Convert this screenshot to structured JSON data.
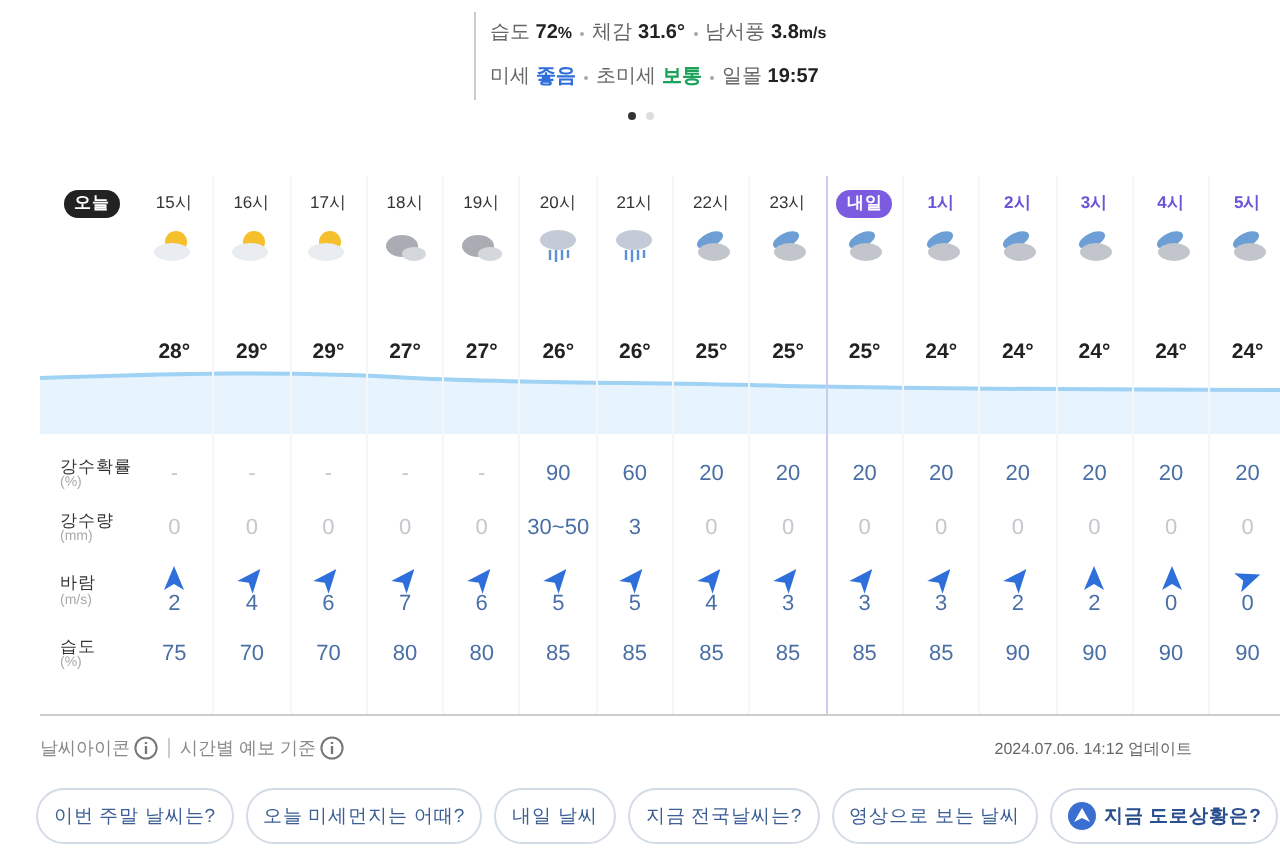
{
  "summary": {
    "lines": [
      [
        {
          "label": "습도",
          "value": "72",
          "unit": "%"
        },
        {
          "label": "체감",
          "value": "31.6°"
        },
        {
          "label": "남서풍",
          "value": "3.8",
          "unit": "m/s"
        }
      ],
      [
        {
          "label": "미세",
          "value": "좋음",
          "color": "#2f6fdb"
        },
        {
          "label": "초미세",
          "value": "보통",
          "color": "#1aa15a"
        },
        {
          "label": "일몰",
          "value": "19:57"
        }
      ]
    ],
    "pages": [
      {
        "selected": true
      },
      {
        "selected": false
      }
    ]
  },
  "timeline": {
    "columns": [
      {
        "kind": "hour",
        "label": "15시",
        "next_day": false,
        "sky": {
          "kind": "partly-sunny"
        },
        "temp": "28°"
      },
      {
        "kind": "hour",
        "label": "16시",
        "next_day": false,
        "sky": {
          "kind": "partly-sunny"
        },
        "temp": "29°"
      },
      {
        "kind": "hour",
        "label": "17시",
        "next_day": false,
        "sky": {
          "kind": "partly-sunny"
        },
        "temp": "29°"
      },
      {
        "kind": "hour",
        "label": "18시",
        "next_day": false,
        "sky": {
          "kind": "cloudy"
        },
        "temp": "27°"
      },
      {
        "kind": "hour",
        "label": "19시",
        "next_day": false,
        "sky": {
          "kind": "cloudy"
        },
        "temp": "27°"
      },
      {
        "kind": "hour",
        "label": "20시",
        "next_day": false,
        "sky": {
          "kind": "rain"
        },
        "temp": "26°"
      },
      {
        "kind": "hour",
        "label": "21시",
        "next_day": false,
        "sky": {
          "kind": "rain"
        },
        "temp": "26°"
      },
      {
        "kind": "hour",
        "label": "22시",
        "next_day": false,
        "sky": {
          "kind": "night-cloud"
        },
        "temp": "25°"
      },
      {
        "kind": "hour",
        "label": "23시",
        "next_day": false,
        "sky": {
          "kind": "night-cloud"
        },
        "temp": "25°"
      },
      {
        "kind": "day-badge",
        "label": "내일",
        "next_day": true,
        "sky": {
          "kind": "night-cloud"
        },
        "temp": "25°"
      },
      {
        "kind": "hour",
        "label": "1시",
        "next_day": true,
        "sky": {
          "kind": "night-cloud"
        },
        "temp": "24°"
      },
      {
        "kind": "hour",
        "label": "2시",
        "next_day": true,
        "sky": {
          "kind": "night-cloud"
        },
        "temp": "24°"
      },
      {
        "kind": "hour",
        "label": "3시",
        "next_day": true,
        "sky": {
          "kind": "night-cloud"
        },
        "temp": "24°"
      },
      {
        "kind": "hour",
        "label": "4시",
        "next_day": true,
        "sky": {
          "kind": "night-cloud"
        },
        "temp": "24°"
      },
      {
        "kind": "hour",
        "label": "5시",
        "next_day": true,
        "sky": {
          "kind": "night-cloud"
        },
        "temp": "24°"
      }
    ],
    "today_badge": "오늘",
    "rows": [
      {
        "kind": "values",
        "label": "강수확률",
        "unit": "(%)",
        "cells": [
          {
            "text": "-",
            "muted": true
          },
          {
            "text": "-",
            "muted": true
          },
          {
            "text": "-",
            "muted": true
          },
          {
            "text": "-",
            "muted": true
          },
          {
            "text": "-",
            "muted": true
          },
          {
            "text": "90",
            "muted": false
          },
          {
            "text": "60",
            "muted": false
          },
          {
            "text": "20",
            "muted": false
          },
          {
            "text": "20",
            "muted": false
          },
          {
            "text": "20",
            "muted": false
          },
          {
            "text": "20",
            "muted": false
          },
          {
            "text": "20",
            "muted": false
          },
          {
            "text": "20",
            "muted": false
          },
          {
            "text": "20",
            "muted": false
          },
          {
            "text": "20",
            "muted": false
          }
        ]
      },
      {
        "kind": "values",
        "label": "강수량",
        "unit": "(mm)",
        "cells": [
          {
            "text": "0",
            "muted": true
          },
          {
            "text": "0",
            "muted": true
          },
          {
            "text": "0",
            "muted": true
          },
          {
            "text": "0",
            "muted": true
          },
          {
            "text": "0",
            "muted": true
          },
          {
            "text": "30~50",
            "muted": false
          },
          {
            "text": "3",
            "muted": false
          },
          {
            "text": "0",
            "muted": true
          },
          {
            "text": "0",
            "muted": true
          },
          {
            "text": "0",
            "muted": true
          },
          {
            "text": "0",
            "muted": true
          },
          {
            "text": "0",
            "muted": true
          },
          {
            "text": "0",
            "muted": true
          },
          {
            "text": "0",
            "muted": true
          },
          {
            "text": "0",
            "muted": true
          }
        ]
      },
      {
        "kind": "wind",
        "label": "바람",
        "unit": "(m/s)",
        "cells": [
          {
            "text": "2",
            "kind": "north"
          },
          {
            "text": "4",
            "kind": "northeast"
          },
          {
            "text": "6",
            "kind": "northeast"
          },
          {
            "text": "7",
            "kind": "northeast"
          },
          {
            "text": "6",
            "kind": "northeast"
          },
          {
            "text": "5",
            "kind": "northeast"
          },
          {
            "text": "5",
            "kind": "northeast"
          },
          {
            "text": "4",
            "kind": "northeast"
          },
          {
            "text": "3",
            "kind": "northeast"
          },
          {
            "text": "3",
            "kind": "northeast"
          },
          {
            "text": "3",
            "kind": "northeast"
          },
          {
            "text": "2",
            "kind": "northeast"
          },
          {
            "text": "2",
            "kind": "north"
          },
          {
            "text": "0",
            "kind": "north"
          },
          {
            "text": "0",
            "kind": "east"
          }
        ]
      },
      {
        "kind": "values",
        "label": "습도",
        "unit": "(%)",
        "cells": [
          {
            "text": "75",
            "muted": false
          },
          {
            "text": "70",
            "muted": false
          },
          {
            "text": "70",
            "muted": false
          },
          {
            "text": "80",
            "muted": false
          },
          {
            "text": "80",
            "muted": false
          },
          {
            "text": "85",
            "muted": false
          },
          {
            "text": "85",
            "muted": false
          },
          {
            "text": "85",
            "muted": false
          },
          {
            "text": "85",
            "muted": false
          },
          {
            "text": "85",
            "muted": false
          },
          {
            "text": "85",
            "muted": false
          },
          {
            "text": "90",
            "muted": false
          },
          {
            "text": "90",
            "muted": false
          },
          {
            "text": "90",
            "muted": false
          },
          {
            "text": "90",
            "muted": false
          }
        ]
      }
    ]
  },
  "footer": {
    "notes": [
      "날씨아이콘",
      "시간별 예보 기준"
    ],
    "updated": "2024.07.06. 14:12 업데이트"
  },
  "chips": [
    {
      "kind": "plain",
      "label": "이번 주말 날씨는?"
    },
    {
      "kind": "plain",
      "label": "오늘 미세먼지는 어때?"
    },
    {
      "kind": "plain",
      "label": "내일 날씨"
    },
    {
      "kind": "plain",
      "label": "지금 전국날씨는?"
    },
    {
      "kind": "plain",
      "label": "영상으로 보는 날씨"
    },
    {
      "kind": "icon",
      "label": "지금 도로상황은?"
    }
  ]
}
